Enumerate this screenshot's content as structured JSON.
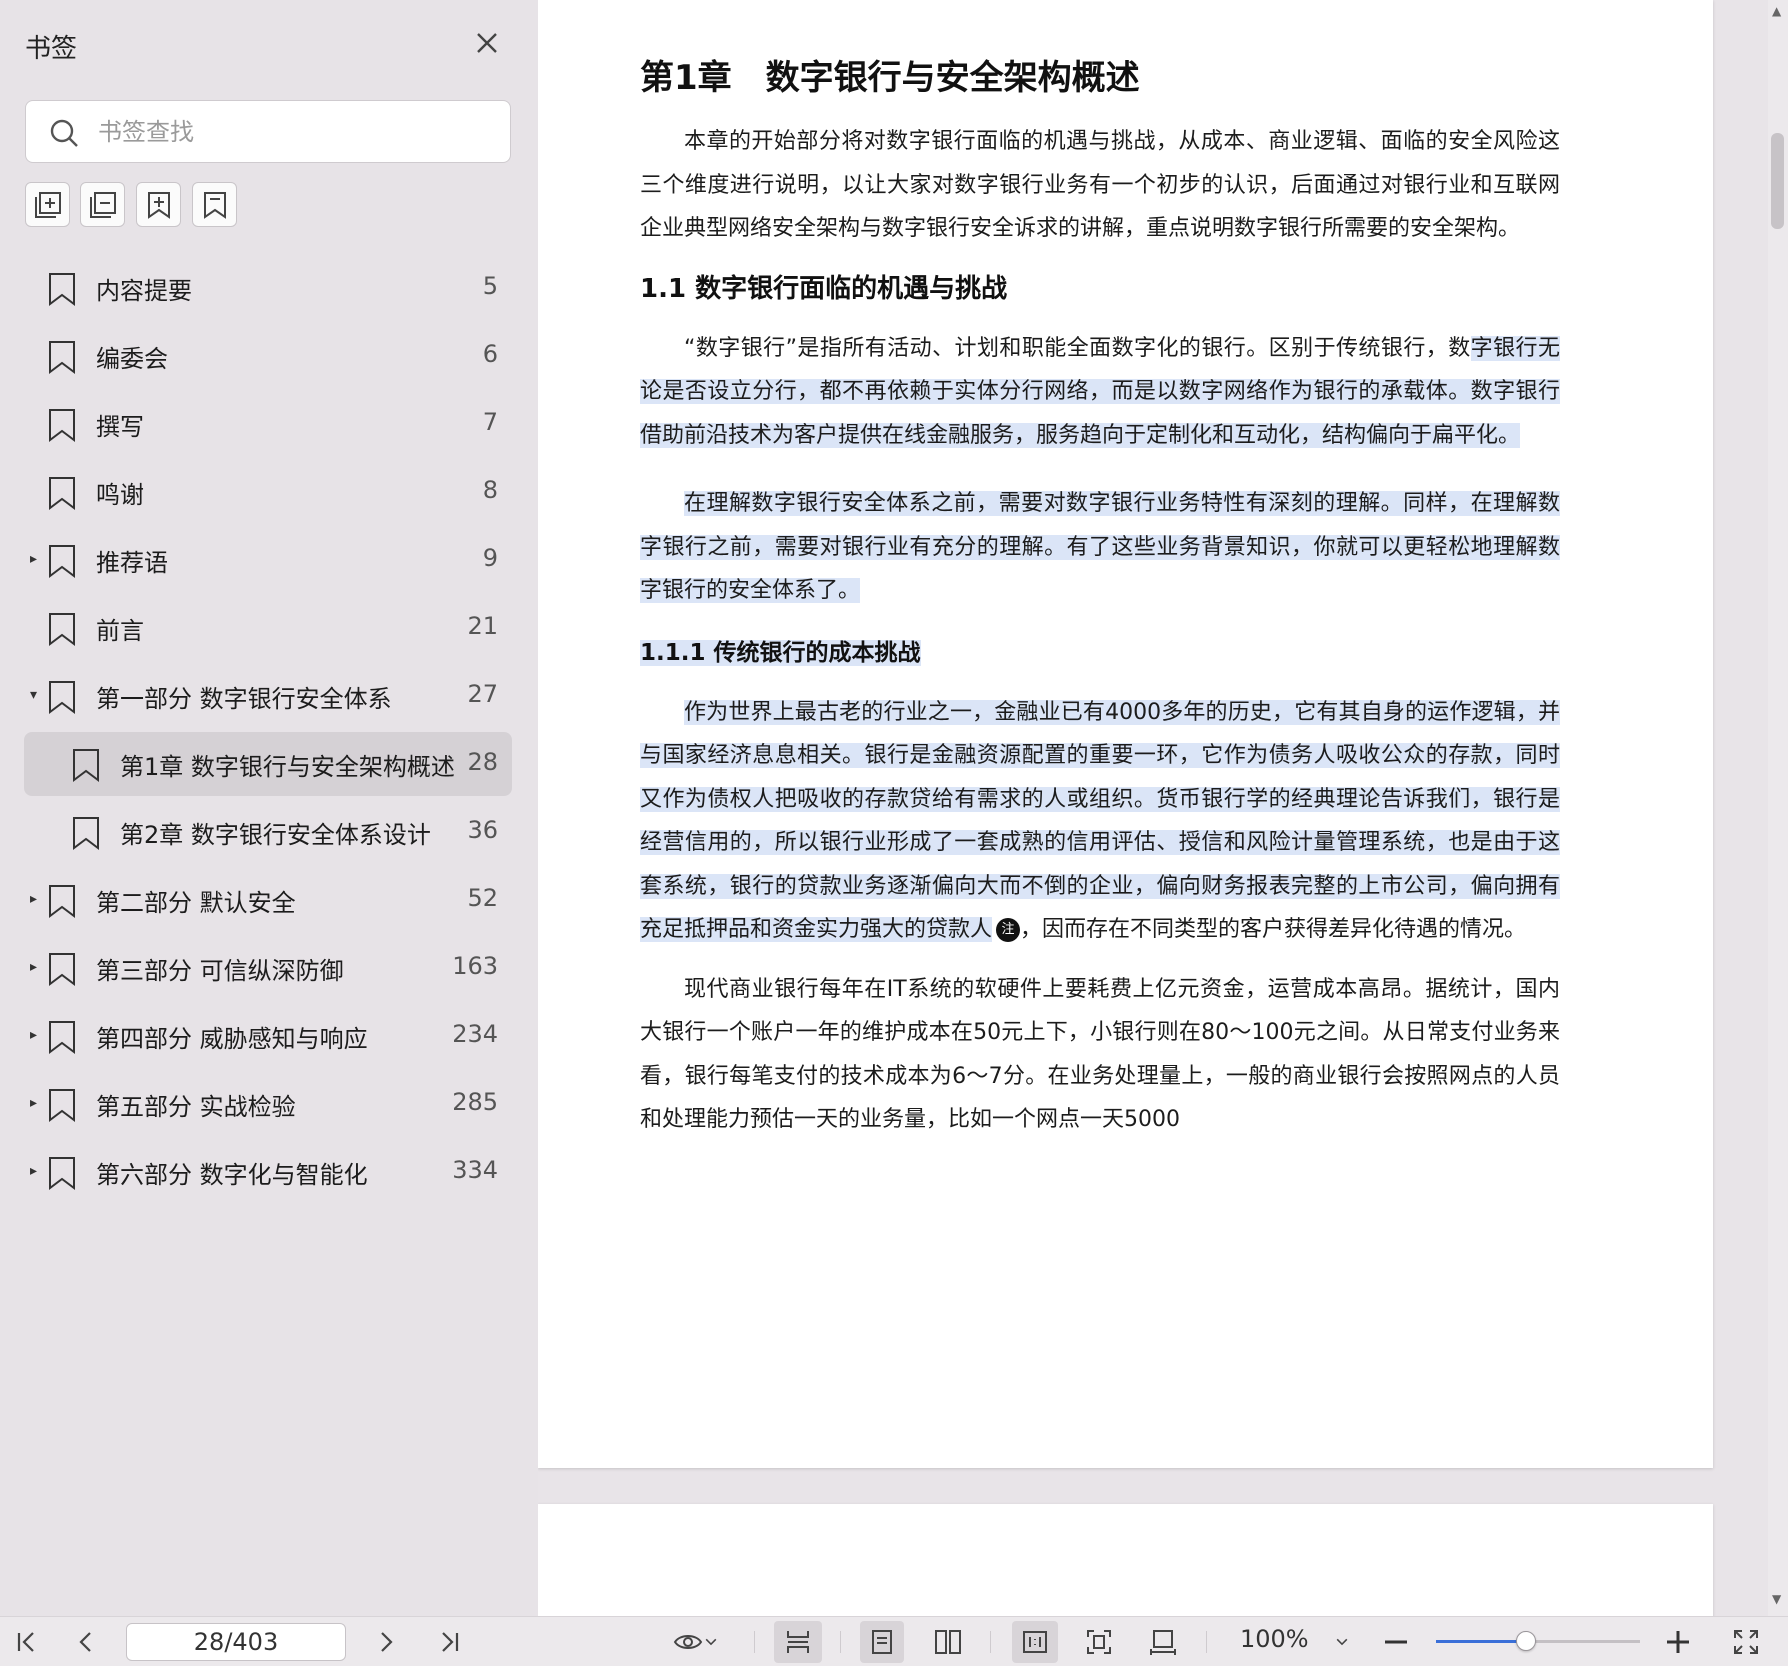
{
  "sidebar": {
    "title": "书签",
    "search_placeholder": "书签查找",
    "tools": [
      "expand-all-icon",
      "collapse-all-icon",
      "add-bookmark-icon",
      "bookmark-icon"
    ],
    "items": [
      {
        "label": "内容提要",
        "page": "5",
        "arrow": "",
        "level": 0
      },
      {
        "label": "编委会",
        "page": "6",
        "arrow": "",
        "level": 0
      },
      {
        "label": "撰写",
        "page": "7",
        "arrow": "",
        "level": 0
      },
      {
        "label": "鸣谢",
        "page": "8",
        "arrow": "",
        "level": 0
      },
      {
        "label": "推荐语",
        "page": "9",
        "arrow": "▸",
        "level": 0
      },
      {
        "label": "前言",
        "page": "21",
        "arrow": "",
        "level": 0
      },
      {
        "label": "第一部分 数字银行安全体系",
        "page": "27",
        "arrow": "▾",
        "level": 0
      },
      {
        "label": "第1章 数字银行与安全架构概述",
        "page": "28",
        "arrow": "",
        "level": 1,
        "active": true
      },
      {
        "label": "第2章 数字银行安全体系设计",
        "page": "36",
        "arrow": "",
        "level": 1
      },
      {
        "label": "第二部分 默认安全",
        "page": "52",
        "arrow": "▸",
        "level": 0
      },
      {
        "label": "第三部分 可信纵深防御",
        "page": "163",
        "arrow": "▸",
        "level": 0
      },
      {
        "label": "第四部分 威胁感知与响应",
        "page": "234",
        "arrow": "▸",
        "level": 0
      },
      {
        "label": "第五部分 实战检验",
        "page": "285",
        "arrow": "▸",
        "level": 0
      },
      {
        "label": "第六部分 数字化与智能化",
        "page": "334",
        "arrow": "▸",
        "level": 0
      }
    ]
  },
  "document": {
    "chapter_title": "第1章　数字银行与安全架构概述",
    "intro": "本章的开始部分将对数字银行面临的机遇与挑战，从成本、商业逻辑、面临的安全风险这三个维度进行说明，以让大家对数字银行业务有一个初步的认识，后面通过对银行业和互联网企业典型网络安全架构与数字银行安全诉求的讲解，重点说明数字银行所需要的安全架构。",
    "section_1_1": "1.1 数字银行面临的机遇与挑战",
    "p1_plain": "“数字银行”是指所有活动、计划和职能全面数字化的银行。区别于传统银行，数",
    "p1_hl": "字银行无论是否设立分行，都不再依赖于实体分行网络，而是以数字网络作为银行的承载体。数字银行借助前沿技术为客户提供在线金融服务，服务趋向于定制化和互动化，结构偏向于扁平化。",
    "p2": "在理解数字银行安全体系之前，需要对数字银行业务特性有深刻的理解。同样，在理解数字银行之前，需要对银行业有充分的理解。有了这些业务背景知识，你就可以更轻松地理解数字银行的安全体系了。",
    "section_1_1_1": "1.1.1 传统银行的成本挑战",
    "p3_hl": "作为世界上最古老的行业之一，金融业已有4000多年的历史，它有其自身的运作逻辑，并与国家经济息息相关。银行是金融资源配置的重要一环，它作为债务人吸收公众的存款，同时又作为债权人把吸收的存款贷给有需求的人或组织。货币银行学的经典理论告诉我们，银行是经营信用的，所以银行业形成了一套成熟的信用评估、授信和风险计量管理系统，也是由于这套系统，银行的贷款业务逐渐偏向大而不倒的企业，偏向财务报表完整的上市公司，偏向拥有充足抵押品和资金实力强大的贷款人",
    "note_label": "注",
    "p3_tail": "，因而存在不同类型的客户获得差异化待遇的情况。",
    "p4": "现代商业银行每年在IT系统的软硬件上要耗费上亿元资金，运营成本高昂。据统计，国内大银行一个账户一年的维护成本在50元上下，小银行则在80～100元之间。从日常支付业务来看，银行每笔支付的技术成本为6～7分。在业务处理量上，一般的商业银行会按照网点的人员和处理能力预估一天的业务量，比如一个网点一天5000"
  },
  "toolbar": {
    "page_value": "28/403",
    "zoom": "100%",
    "zoom_fraction": 0.44
  },
  "colors": {
    "highlight": "#dbe5f7",
    "sidebar_bg": "#e7e3e7",
    "accent": "#3a6fd8"
  }
}
